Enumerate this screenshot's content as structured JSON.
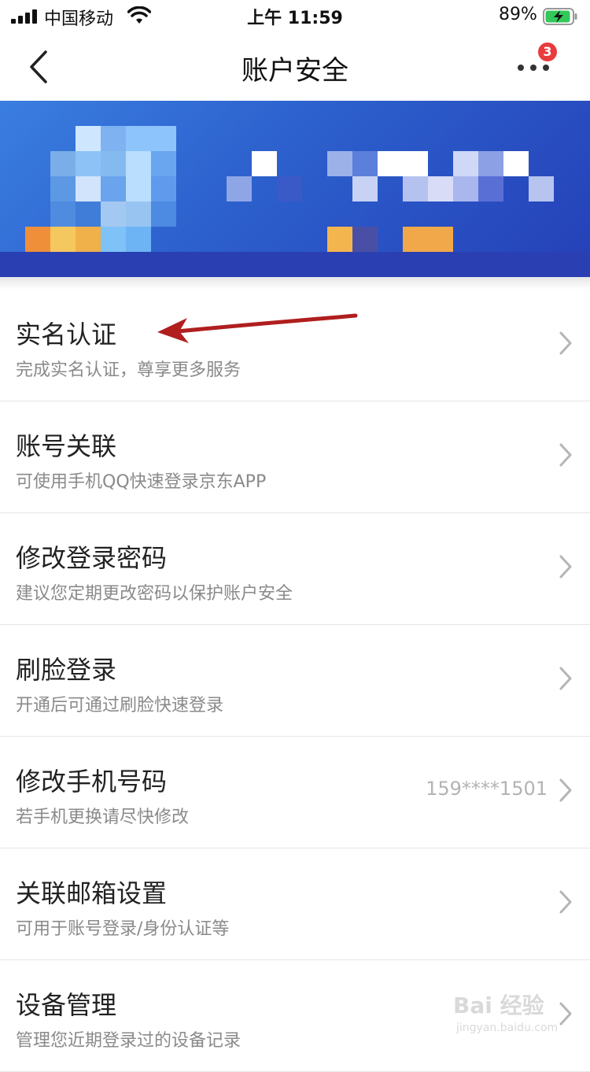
{
  "status_bar": {
    "carrier": "中国移动",
    "time": "上午 11:59",
    "battery": "89%"
  },
  "nav": {
    "title": "账户安全",
    "badge_count": "3"
  },
  "banner": {
    "blurred": true
  },
  "items": [
    {
      "title": "实名认证",
      "subtitle": "完成实名认证，尊享更多服务",
      "value": ""
    },
    {
      "title": "账号关联",
      "subtitle": "可使用手机QQ快速登录京东APP",
      "value": ""
    },
    {
      "title": "修改登录密码",
      "subtitle": "建议您定期更改密码以保护账户安全",
      "value": ""
    },
    {
      "title": "刷脸登录",
      "subtitle": "开通后可通过刷脸快速登录",
      "value": ""
    },
    {
      "title": "修改手机号码",
      "subtitle": "若手机更换请尽快修改",
      "value": "159****1501"
    },
    {
      "title": "关联邮箱设置",
      "subtitle": "可用于账号登录/身份认证等",
      "value": ""
    },
    {
      "title": "设备管理",
      "subtitle": "管理您近期登录过的设备记录",
      "value": ""
    }
  ],
  "watermark": {
    "text": "Bai 经验",
    "sub": "jingyan.baidu.com"
  },
  "colors": {
    "badge": "#e93b3d",
    "annotation_arrow": "#b01e1e",
    "banner_blue": "#2c5fcc"
  }
}
